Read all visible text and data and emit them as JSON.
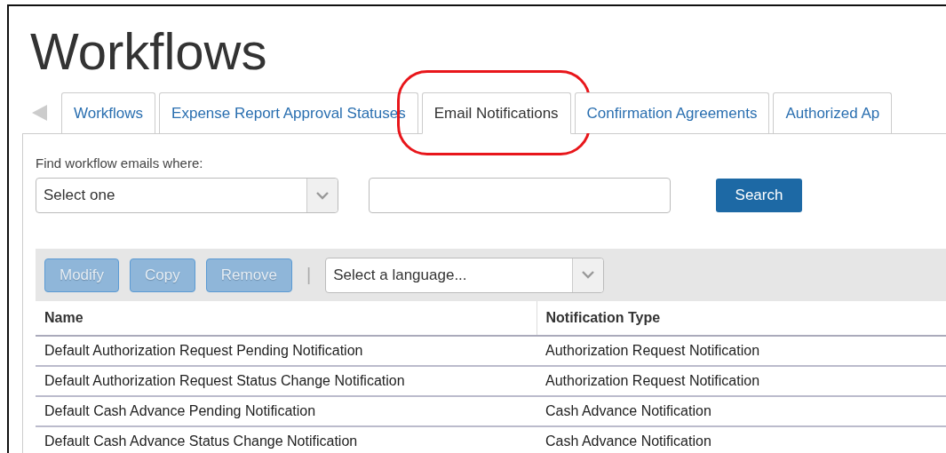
{
  "page": {
    "title": "Workflows"
  },
  "tabs": [
    {
      "label": "Workflows",
      "selected": false,
      "circled": false
    },
    {
      "label": "Expense Report Approval Statuses",
      "selected": false,
      "circled": false
    },
    {
      "label": "Email Notifications",
      "selected": true,
      "circled": true
    },
    {
      "label": "Confirmation Agreements",
      "selected": false,
      "circled": false
    },
    {
      "label": "Authorized Ap",
      "selected": false,
      "circled": false
    }
  ],
  "search": {
    "label": "Find workflow emails where:",
    "criteria": "Select one",
    "button": "Search"
  },
  "toolbar": {
    "buttons": [
      {
        "label": "Modify",
        "disabled": true
      },
      {
        "label": "Copy",
        "disabled": true
      },
      {
        "label": "Remove",
        "disabled": true
      }
    ],
    "separator": "|",
    "language": "Select a language..."
  },
  "table": {
    "columns": [
      "Name",
      "Notification Type"
    ],
    "rows": [
      [
        "Default Authorization Request Pending Notification",
        "Authorization Request Notification"
      ],
      [
        "Default Authorization Request Status Change Notification",
        "Authorization Request Notification"
      ],
      [
        "Default Cash Advance Pending Notification",
        "Cash Advance Notification"
      ],
      [
        "Default Cash Advance Status Change Notification",
        "Cash Advance Notification"
      ]
    ]
  }
}
